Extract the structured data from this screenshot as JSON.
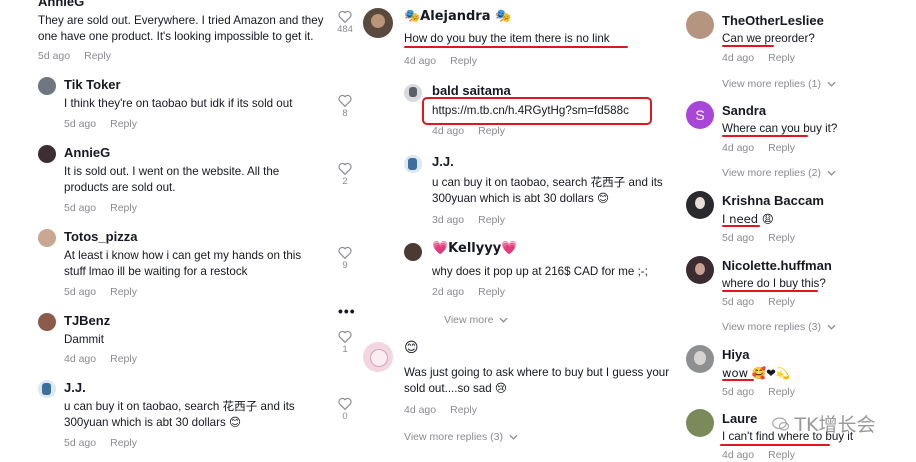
{
  "colors": {
    "accent_red": "#e1161f",
    "meta_gray": "#8a8b91",
    "text": "#161823"
  },
  "reply_label": "Reply",
  "col1": {
    "comments": [
      {
        "user": "AnnieG",
        "text": "They are sold out. Everywhere. I tried Amazon and they\none have one product. It's looking impossible to get it.",
        "age": "5d ago",
        "likes": "484"
      },
      {
        "user": "Tik Toker",
        "text": "I think they're on taobao but idk if its sold out",
        "age": "5d ago",
        "likes": "8"
      },
      {
        "user": "AnnieG",
        "text": "It is sold out. I went on the website. All the\nproducts are sold out.",
        "age": "5d ago",
        "likes": "2"
      },
      {
        "user": "Totos_pizza",
        "text": "At least i know how i can get my hands on this\nstuff lmao ill be waiting for a restock",
        "age": "5d ago",
        "likes": "9"
      },
      {
        "user": "TJBenz",
        "text": "Dammit",
        "age": "4d ago",
        "likes": "1"
      },
      {
        "user": "J.J.",
        "text": "u can buy it on taobao, search 花西子 and its\n300yuan which is abt 30 dollars 😊",
        "age": "5d ago",
        "likes": "0"
      }
    ]
  },
  "col2": {
    "top": {
      "user": "🎭Alejandra 🎭",
      "text": "How do you buy the item there is no link",
      "age": "4d ago"
    },
    "replies": [
      {
        "user": "bald saitama",
        "text": "https://m.tb.cn/h.4RGytHg?sm=fd588c",
        "age": "4d ago"
      },
      {
        "user": "J.J.",
        "text": "u can buy it on taobao, search 花西子 and its\n300yuan which is abt 30 dollars 😊",
        "age": "3d ago"
      },
      {
        "user": "💗Kellyyy💗",
        "text": "why does it pop up at 216$ CAD for me ;-;",
        "age": "2d ago"
      }
    ],
    "view_more_1": "View more",
    "bottom": {
      "user": "😊",
      "text": "Was just going to ask where to buy but I guess your\nsold out....so sad 😢",
      "age": "4d ago"
    },
    "view_more_2": "View more replies (3)"
  },
  "col3": {
    "comments": [
      {
        "user": "TheOtherLesliee",
        "text": "Can we preorder?",
        "age": "4d ago",
        "view_more": "View more replies (1)"
      },
      {
        "user": "Sandra",
        "text": "Where can you buy it?",
        "age": "4d ago",
        "view_more": "View more replies (2)"
      },
      {
        "user": "Krishna Baccam",
        "text": "I need 😩",
        "age": "5d ago",
        "view_more": ""
      },
      {
        "user": "Nicolette.huffman",
        "text": "where do I buy this?",
        "age": "5d ago",
        "view_more": "View more replies (3)"
      },
      {
        "user": "Hiya",
        "text": "wow 🥰❤💫",
        "age": "5d ago",
        "view_more": ""
      },
      {
        "user": "Laure",
        "text": "I can't find where to buy it",
        "age": "4d ago",
        "view_more": ""
      }
    ],
    "sandra_initial": "S"
  },
  "watermark": "TK增长会"
}
